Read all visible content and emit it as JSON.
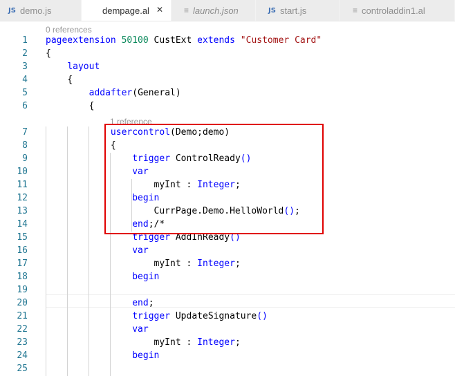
{
  "tabs": [
    {
      "label": "demo.js",
      "icon": "js-icon",
      "italic": false,
      "active": false
    },
    {
      "label": "dempage.al",
      "icon": "none",
      "italic": false,
      "active": true,
      "close": "✕"
    },
    {
      "label": "launch.json",
      "icon": "json-icon",
      "italic": true,
      "active": false
    },
    {
      "label": "start.js",
      "icon": "js-icon",
      "italic": false,
      "active": false
    },
    {
      "label": "controladdin1.al",
      "icon": "al-icon",
      "italic": false,
      "active": false
    }
  ],
  "icons": {
    "js_text": "JS",
    "json_glyph": "≡",
    "al_glyph": "≡"
  },
  "codelens": {
    "top": "0 references",
    "usercontrol": "1 reference"
  },
  "lines": [
    {
      "n": "1",
      "code": "pageextension 50100 CustExt extends \"Customer Card\""
    },
    {
      "n": "2",
      "code": "{"
    },
    {
      "n": "3",
      "code": "    layout"
    },
    {
      "n": "4",
      "code": "    {"
    },
    {
      "n": "5",
      "code": "        addafter(General)"
    },
    {
      "n": "6",
      "code": "        {"
    },
    {
      "n": "7",
      "code": "            usercontrol(Demo;demo)"
    },
    {
      "n": "8",
      "code": "            {"
    },
    {
      "n": "9",
      "code": "                trigger ControlReady()"
    },
    {
      "n": "10",
      "code": "                var"
    },
    {
      "n": "11",
      "code": "                    myInt : Integer;"
    },
    {
      "n": "12",
      "code": "                begin"
    },
    {
      "n": "13",
      "code": "                    CurrPage.Demo.HelloWorld();"
    },
    {
      "n": "14",
      "code": "                end;/*"
    },
    {
      "n": "15",
      "code": "                trigger AddInReady()"
    },
    {
      "n": "16",
      "code": "                var"
    },
    {
      "n": "17",
      "code": "                    myInt : Integer;"
    },
    {
      "n": "18",
      "code": "                begin"
    },
    {
      "n": "19",
      "code": ""
    },
    {
      "n": "20",
      "code": "                end;"
    },
    {
      "n": "21",
      "code": "                trigger UpdateSignature()"
    },
    {
      "n": "22",
      "code": "                var"
    },
    {
      "n": "23",
      "code": "                    myInt : Integer;"
    },
    {
      "n": "24",
      "code": "                begin"
    },
    {
      "n": "25",
      "code": ""
    }
  ],
  "colors": {
    "keyword": "#0000ff",
    "string": "#a31515",
    "number": "#09885a",
    "line_number": "#237893",
    "highlight": "#e00000"
  }
}
